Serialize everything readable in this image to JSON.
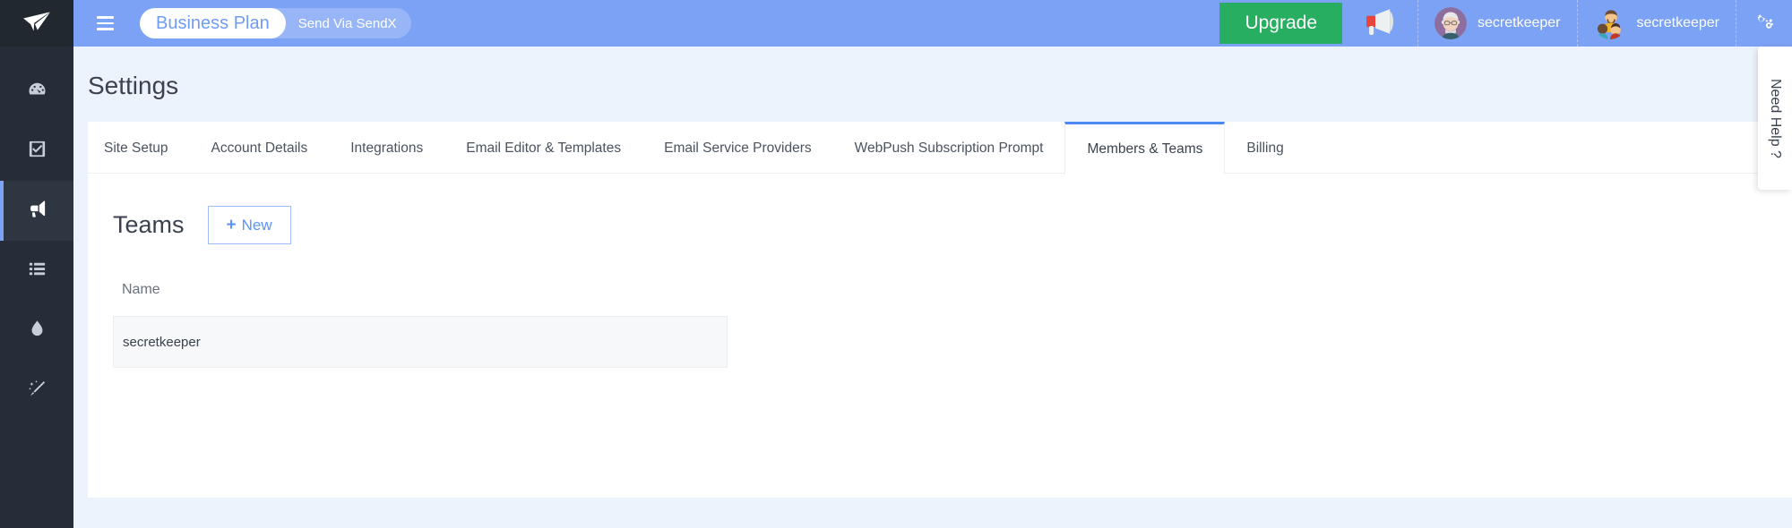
{
  "colors": {
    "rail_bg": "#262d38",
    "rail_active_bg": "#2e3641",
    "topbar_bg": "#7ba2f5",
    "accent_blue": "#4c8bf5",
    "upgrade_green": "#27ae60",
    "page_bg": "#edf3fd",
    "card_bg": "#ffffff",
    "row_bg": "#f7f8f9"
  },
  "sidebar": {
    "logo_icon": "paper-plane-icon",
    "items": [
      {
        "icon": "dashboard-speedometer-icon",
        "name": "dashboard",
        "active": false
      },
      {
        "icon": "checkbox-checked-icon",
        "name": "tasks",
        "active": false
      },
      {
        "icon": "megaphone-icon",
        "name": "campaigns",
        "active": true
      },
      {
        "icon": "list-icon",
        "name": "lists",
        "active": false
      },
      {
        "icon": "droplet-icon",
        "name": "drip",
        "active": false
      },
      {
        "icon": "magic-wand-icon",
        "name": "automation",
        "active": false
      }
    ]
  },
  "topbar": {
    "menu_icon": "hamburger-icon",
    "plan_name": "Business Plan",
    "plan_subtitle": "Send Via SendX",
    "upgrade_label": "Upgrade",
    "announcement_icon": "megaphone-icon",
    "user_account": {
      "avatar_icon": "user-avatar-icon",
      "name": "secretkeeper"
    },
    "team_account": {
      "avatar_icon": "team-avatar-icon",
      "name": "secretkeeper"
    },
    "settings_icon": "gears-icon"
  },
  "page": {
    "title": "Settings"
  },
  "tabs": [
    {
      "label": "Site Setup",
      "active": false
    },
    {
      "label": "Account Details",
      "active": false
    },
    {
      "label": "Integrations",
      "active": false
    },
    {
      "label": "Email Editor & Templates",
      "active": false
    },
    {
      "label": "Email Service Providers",
      "active": false
    },
    {
      "label": "WebPush Subscription Prompt",
      "active": false
    },
    {
      "label": "Members & Teams",
      "active": true
    },
    {
      "label": "Billing",
      "active": false
    }
  ],
  "teams_section": {
    "title": "Teams",
    "new_button": {
      "plus": "+",
      "label": "New"
    },
    "table": {
      "columns": [
        "Name"
      ],
      "rows": [
        {
          "name": "secretkeeper"
        }
      ]
    }
  },
  "help_tab": {
    "label": "Need Help ?"
  }
}
